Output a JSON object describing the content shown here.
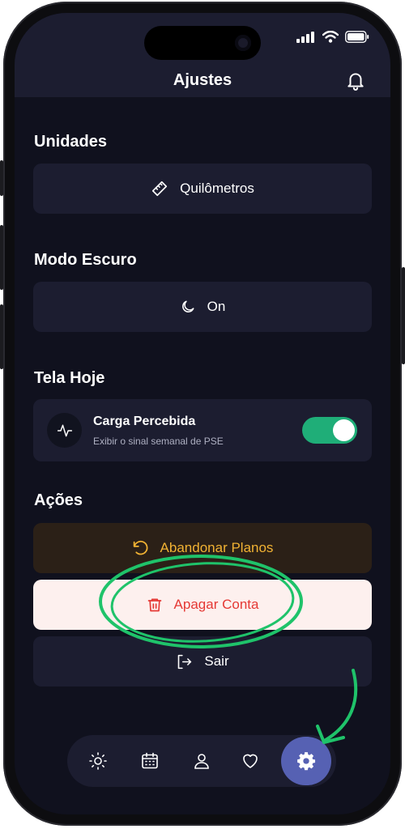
{
  "header": {
    "title": "Ajustes"
  },
  "sections": {
    "units": {
      "title": "Unidades",
      "value": "Quilômetros"
    },
    "dark_mode": {
      "title": "Modo Escuro",
      "value": "On"
    },
    "today_screen": {
      "title": "Tela Hoje",
      "item_label": "Carga Percebida",
      "item_description": "Exibir o sinal semanal de PSE",
      "toggle_on": true
    },
    "actions": {
      "title": "Ações",
      "abandon_label": "Abandonar Planos",
      "delete_label": "Apagar Conta",
      "logout_label": "Sair"
    }
  },
  "nav": {
    "items": [
      "sun-icon",
      "calendar-icon",
      "profile-icon",
      "heart-icon",
      "settings-icon"
    ],
    "active": "settings-icon"
  },
  "colors": {
    "background": "#10111e",
    "card": "#1c1d30",
    "toggle_on": "#1fae78",
    "abandon_text": "#f1b233",
    "delete_text": "#e53935",
    "nav_active": "#5661b3",
    "annotation": "#1fc36a"
  }
}
